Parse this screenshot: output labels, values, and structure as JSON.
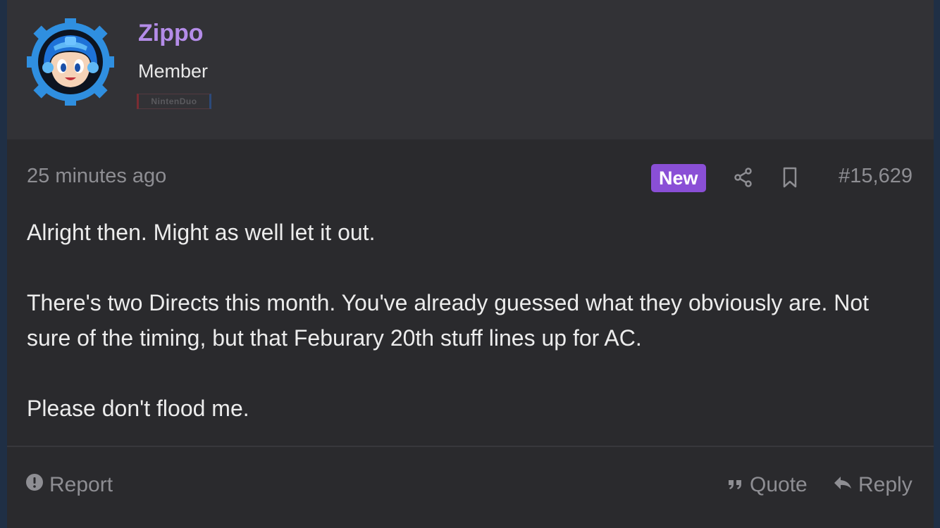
{
  "user": {
    "name": "Zippo",
    "title": "Member",
    "banner": "NintenDuo",
    "avatar_icon": "mega-man-avatar-icon"
  },
  "post": {
    "time": "25 minutes ago",
    "badge": "New",
    "number": "#15,629",
    "paragraphs": [
      "Alright then. Might as well let it out.",
      "There's two Directs this month. You've already guessed what they obviously are. Not sure of the timing, but that Feburary 20th stuff lines up for AC.",
      "Please don't flood me."
    ]
  },
  "actions": {
    "report": "Report",
    "quote": "Quote",
    "reply": "Reply"
  },
  "colors": {
    "username": "#b48ce8",
    "badge": "#8a4fd6",
    "muted": "#8e8e93",
    "text": "#ececec"
  }
}
